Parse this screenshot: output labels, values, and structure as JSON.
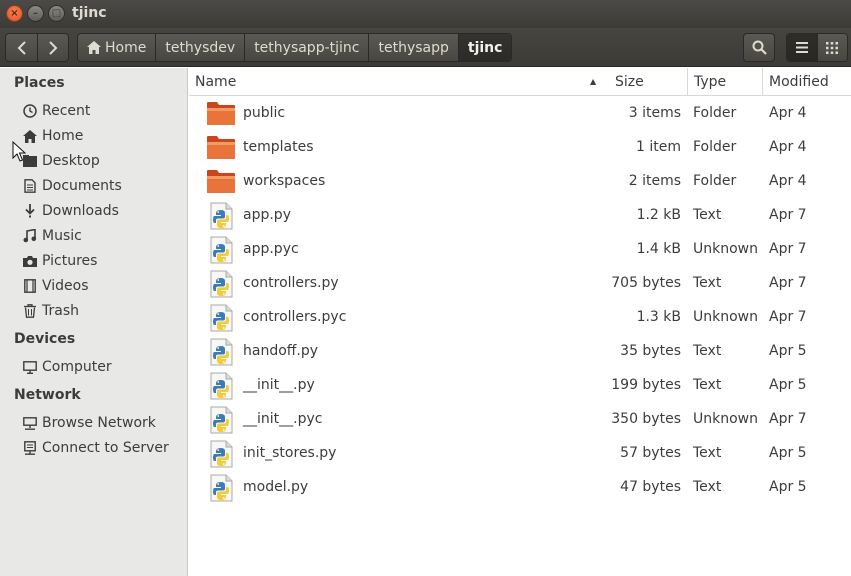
{
  "window": {
    "title": "tjinc"
  },
  "breadcrumbs": [
    "Home",
    "tethysdev",
    "tethysapp-tjinc",
    "tethysapp",
    "tjinc"
  ],
  "sidebar": {
    "places_header": "Places",
    "places": [
      {
        "label": "Recent",
        "icon": "clock-icon"
      },
      {
        "label": "Home",
        "icon": "home-icon"
      },
      {
        "label": "Desktop",
        "icon": "desktop-icon"
      },
      {
        "label": "Documents",
        "icon": "document-icon"
      },
      {
        "label": "Downloads",
        "icon": "download-icon"
      },
      {
        "label": "Music",
        "icon": "music-icon"
      },
      {
        "label": "Pictures",
        "icon": "camera-icon"
      },
      {
        "label": "Videos",
        "icon": "film-icon"
      },
      {
        "label": "Trash",
        "icon": "trash-icon"
      }
    ],
    "devices_header": "Devices",
    "devices": [
      {
        "label": "Computer",
        "icon": "computer-icon"
      }
    ],
    "network_header": "Network",
    "network": [
      {
        "label": "Browse Network",
        "icon": "network-icon"
      },
      {
        "label": "Connect to Server",
        "icon": "server-icon"
      }
    ]
  },
  "columns": {
    "name": "Name",
    "size": "Size",
    "type": "Type",
    "modified": "Modified"
  },
  "files": [
    {
      "name": "public",
      "size": "3 items",
      "type": "Folder",
      "modified": "Apr 4",
      "icon": "folder-icon"
    },
    {
      "name": "templates",
      "size": "1 item",
      "type": "Folder",
      "modified": "Apr 4",
      "icon": "folder-icon"
    },
    {
      "name": "workspaces",
      "size": "2 items",
      "type": "Folder",
      "modified": "Apr 4",
      "icon": "folder-icon"
    },
    {
      "name": "app.py",
      "size": "1.2 kB",
      "type": "Text",
      "modified": "Apr 7",
      "icon": "python-file-icon"
    },
    {
      "name": "app.pyc",
      "size": "1.4 kB",
      "type": "Unknown",
      "modified": "Apr 7",
      "icon": "python-file-icon"
    },
    {
      "name": "controllers.py",
      "size": "705 bytes",
      "type": "Text",
      "modified": "Apr 7",
      "icon": "python-file-icon"
    },
    {
      "name": "controllers.pyc",
      "size": "1.3 kB",
      "type": "Unknown",
      "modified": "Apr 7",
      "icon": "python-file-icon"
    },
    {
      "name": "handoff.py",
      "size": "35 bytes",
      "type": "Text",
      "modified": "Apr 5",
      "icon": "python-file-icon"
    },
    {
      "name": "__init__.py",
      "size": "199 bytes",
      "type": "Text",
      "modified": "Apr 5",
      "icon": "python-file-icon"
    },
    {
      "name": "__init__.pyc",
      "size": "350 bytes",
      "type": "Unknown",
      "modified": "Apr 7",
      "icon": "python-file-icon"
    },
    {
      "name": "init_stores.py",
      "size": "57 bytes",
      "type": "Text",
      "modified": "Apr 5",
      "icon": "python-file-icon"
    },
    {
      "name": "model.py",
      "size": "47 bytes",
      "type": "Text",
      "modified": "Apr 5",
      "icon": "python-file-icon"
    }
  ],
  "colors": {
    "titlebar": "#3c3b37",
    "close_button": "#e0501f",
    "folder": "#e0642b",
    "sidebar_bg": "#e8e8e7"
  }
}
